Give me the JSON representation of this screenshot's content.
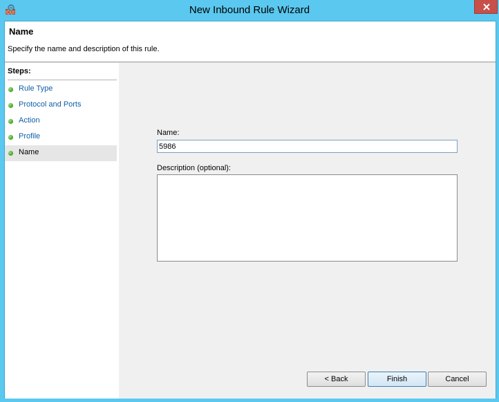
{
  "window": {
    "title": "New Inbound Rule Wizard"
  },
  "header": {
    "title": "Name",
    "description": "Specify the name and description of this rule."
  },
  "steps": {
    "title": "Steps:",
    "items": [
      {
        "label": "Rule Type",
        "current": false
      },
      {
        "label": "Protocol and Ports",
        "current": false
      },
      {
        "label": "Action",
        "current": false
      },
      {
        "label": "Profile",
        "current": false
      },
      {
        "label": "Name",
        "current": true
      }
    ]
  },
  "form": {
    "name_label": "Name:",
    "name_value": "5986",
    "description_label": "Description (optional):",
    "description_value": ""
  },
  "buttons": {
    "back": "< Back",
    "finish": "Finish",
    "cancel": "Cancel"
  },
  "colors": {
    "title_bar": "#5ac8ef",
    "link_text": "#0d5fa8",
    "step_dot": "#3aa221",
    "close_button": "#c7504a"
  }
}
